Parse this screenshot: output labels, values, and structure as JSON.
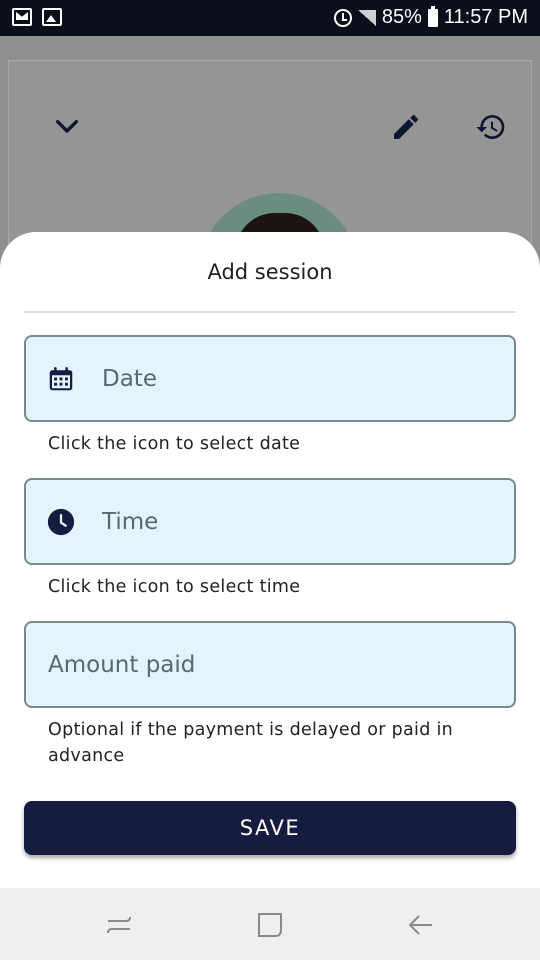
{
  "status_bar": {
    "battery": "85%",
    "time": "11:57 PM"
  },
  "colors": {
    "primary": "#161c40",
    "field_background": "#e2f5fd",
    "field_border": "#7a8794"
  },
  "background_screen": {
    "icons": [
      "chevron-down-icon",
      "pencil-icon",
      "history-icon"
    ]
  },
  "sheet": {
    "title": "Add session",
    "date": {
      "placeholder": "Date",
      "value": "",
      "icon": "calendar-icon",
      "helper": "Click the icon to select date"
    },
    "time": {
      "placeholder": "Time",
      "value": "",
      "icon": "clock-icon",
      "helper": "Click the icon to select time"
    },
    "amount": {
      "placeholder": "Amount paid",
      "value": "",
      "helper": "Optional if the payment is delayed or paid in advance"
    },
    "save_label": "SAVE"
  },
  "nav_bar": {
    "icons": [
      "recent-apps-icon",
      "home-icon",
      "back-icon"
    ]
  }
}
